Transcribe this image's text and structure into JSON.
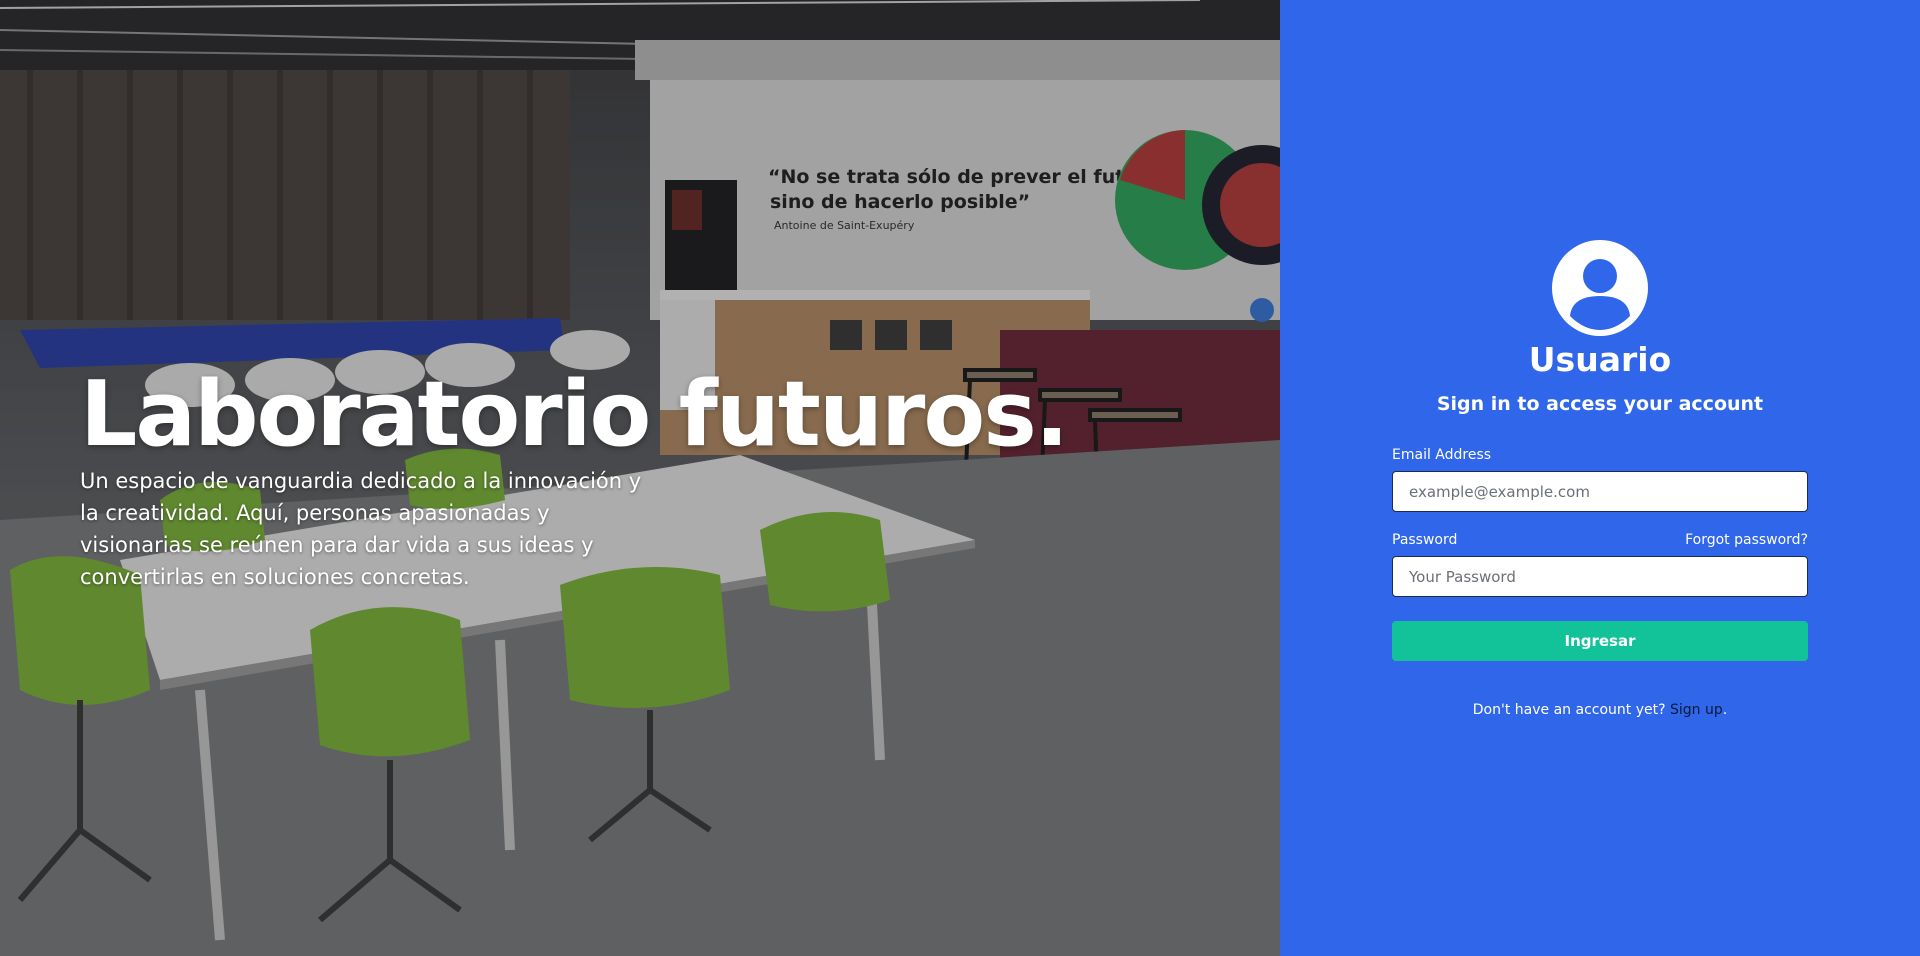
{
  "hero": {
    "title": "Laboratorio futuros.",
    "description": "Un espacio de vanguardia dedicado a la innovación y la creatividad. Aquí, personas apasionadas y visionarias se reúnen para dar vida a sus ideas y convertirlas en soluciones concretas.",
    "photo": {
      "quote_line1": "“No se trata sólo de prever el futuro,",
      "quote_line2": "sino de hacerlo posible”",
      "quote_author": "Antoine de Saint-Exupéry"
    }
  },
  "login": {
    "avatar_icon": "user-circle-icon",
    "title": "Usuario",
    "subtitle": "Sign in to access your account",
    "email_label": "Email Address",
    "email_placeholder": "example@example.com",
    "email_value": "",
    "password_label": "Password",
    "forgot_label": "Forgot password?",
    "password_placeholder": "Your Password",
    "password_value": "",
    "submit_label": "Ingresar",
    "signup_prefix": "Don't have an account yet?",
    "signup_link": "Sign up",
    "signup_suffix": "."
  },
  "colors": {
    "panel": "#2f66ea",
    "button": "#12c39a",
    "text": "#ffffff"
  }
}
